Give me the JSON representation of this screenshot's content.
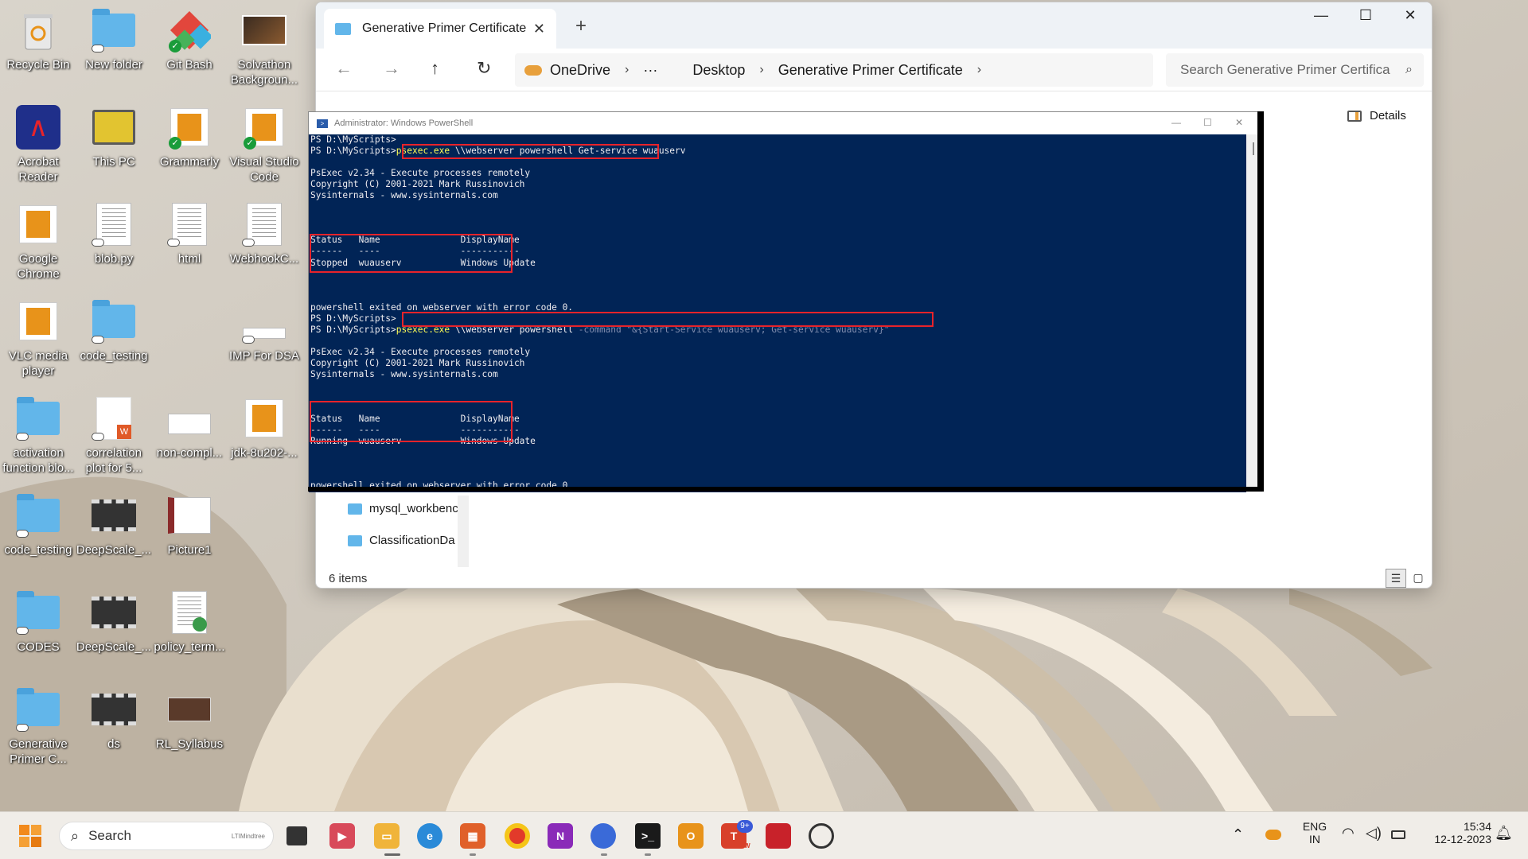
{
  "desktop": {
    "icons": [
      {
        "label": "Recycle Bin",
        "icon": "recycle-bin-icon"
      },
      {
        "label": "New folder",
        "icon": "folder-icon"
      },
      {
        "label": "Git Bash",
        "icon": "git-bash-icon"
      },
      {
        "label": "Solvathon Backgroun...",
        "icon": "image-file-icon"
      },
      {
        "label": "Acrobat Reader",
        "icon": "acrobat-icon"
      },
      {
        "label": "This PC",
        "icon": "monitor-icon"
      },
      {
        "label": "Grammarly",
        "icon": "shortcut-icon"
      },
      {
        "label": "Visual Studio Code",
        "icon": "shortcut-icon"
      },
      {
        "label": "Google Chrome",
        "icon": "shortcut-icon"
      },
      {
        "label": "blob.py",
        "icon": "document-icon"
      },
      {
        "label": "html",
        "icon": "document-icon"
      },
      {
        "label": "WebhookC...",
        "icon": "document-icon"
      },
      {
        "label": "VLC media player",
        "icon": "shortcut-icon"
      },
      {
        "label": "code_testing",
        "icon": "folder-icon"
      },
      {
        "label": "IMP For DSA",
        "icon": "document-icon"
      },
      {
        "label": "activation function blo...",
        "icon": "folder-icon"
      },
      {
        "label": "correlation plot for 5...",
        "icon": "word-document-icon"
      },
      {
        "label": "non-compl...",
        "icon": "document-icon"
      },
      {
        "label": "jdk-8u202-...",
        "icon": "shortcut-icon"
      },
      {
        "label": "code_testing",
        "icon": "folder-icon"
      },
      {
        "label": "DeepScale_...",
        "icon": "video-file-icon"
      },
      {
        "label": "Picture1",
        "icon": "image-file-icon"
      },
      {
        "label": "CODES",
        "icon": "folder-icon"
      },
      {
        "label": "DeepScale_...",
        "icon": "video-file-icon"
      },
      {
        "label": "policy_term...",
        "icon": "document-icon"
      },
      {
        "label": "Generative Primer C...",
        "icon": "folder-icon"
      },
      {
        "label": "ds",
        "icon": "video-file-icon"
      },
      {
        "label": "RL_Syllabus",
        "icon": "image-file-icon"
      }
    ]
  },
  "explorer": {
    "tab_title": "Generative Primer Certificate",
    "breadcrumb": [
      "OneDrive",
      "···",
      "Desktop",
      "Generative Primer Certificate"
    ],
    "search_placeholder": "Search Generative Primer Certifica",
    "details_label": "Details",
    "nav_items": [
      "mysql_workbenc",
      "ClassificationDa"
    ],
    "status": "6 items"
  },
  "powershell": {
    "title": "Administrator: Windows PowerShell",
    "prompt": "PS D:\\MyScripts>",
    "cmd1_exe": "psexec.exe",
    "cmd1_args": " \\\\webserver powershell Get-service wuauserv",
    "banner1": "PsExec v2.34 - Execute processes remotely",
    "banner2": "Copyright (C) 2001-2021 Mark Russinovich",
    "banner3": "Sysinternals - www.sysinternals.com",
    "table_header": "Status   Name               DisplayName",
    "table_rule": "------   ----               -----------",
    "row1": "Stopped  wuauserv           Windows Update",
    "exit_msg": "powershell exited on webserver with error code 0.",
    "cmd2_exe": "psexec.exe",
    "cmd2_args": " \\\\webserver powershell ",
    "cmd2_flag": "-command",
    "cmd2_str": " \"&{Start-Service wuauserv; Get-service wuauserv}\"",
    "row2": "Running  wuauserv           Windows Update"
  },
  "taskbar": {
    "search_label": "Search",
    "search_corner": "LTIMindtree",
    "lang_top": "ENG",
    "lang_bottom": "IN",
    "time": "15:34",
    "date": "12-12-2023",
    "badge_9": "9+",
    "new_label": "NEW"
  }
}
